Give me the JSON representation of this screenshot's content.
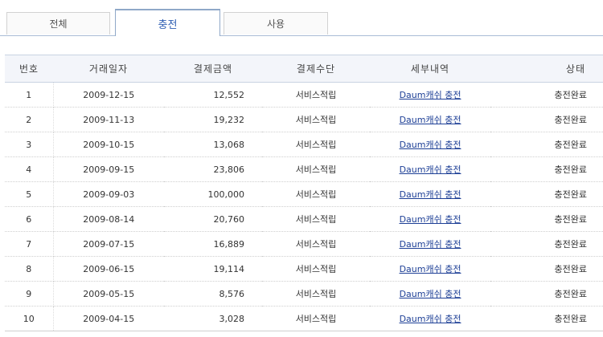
{
  "tabs": {
    "all": "전체",
    "charge": "충전",
    "use": "사용"
  },
  "columns": [
    "번호",
    "거래일자",
    "결제금액",
    "결제수단",
    "세부내역",
    "상태"
  ],
  "rows": [
    {
      "no": "1",
      "date": "2009-12-15",
      "amount": "12,552",
      "method": "서비스적립",
      "detail": "Daum캐쉬 충전",
      "status": "충전완료"
    },
    {
      "no": "2",
      "date": "2009-11-13",
      "amount": "19,232",
      "method": "서비스적립",
      "detail": "Daum캐쉬 충전",
      "status": "충전완료"
    },
    {
      "no": "3",
      "date": "2009-10-15",
      "amount": "13,068",
      "method": "서비스적립",
      "detail": "Daum캐쉬 충전",
      "status": "충전완료"
    },
    {
      "no": "4",
      "date": "2009-09-15",
      "amount": "23,806",
      "method": "서비스적립",
      "detail": "Daum캐쉬 충전",
      "status": "충전완료"
    },
    {
      "no": "5",
      "date": "2009-09-03",
      "amount": "100,000",
      "method": "서비스적립",
      "detail": "Daum캐쉬 충전",
      "status": "충전완료"
    },
    {
      "no": "6",
      "date": "2009-08-14",
      "amount": "20,760",
      "method": "서비스적립",
      "detail": "Daum캐쉬 충전",
      "status": "충전완료"
    },
    {
      "no": "7",
      "date": "2009-07-15",
      "amount": "16,889",
      "method": "서비스적립",
      "detail": "Daum캐쉬 충전",
      "status": "충전완료"
    },
    {
      "no": "8",
      "date": "2009-06-15",
      "amount": "19,114",
      "method": "서비스적립",
      "detail": "Daum캐쉬 충전",
      "status": "충전완료"
    },
    {
      "no": "9",
      "date": "2009-05-15",
      "amount": "8,576",
      "method": "서비스적립",
      "detail": "Daum캐쉬 충전",
      "status": "충전완료"
    },
    {
      "no": "10",
      "date": "2009-04-15",
      "amount": "3,028",
      "method": "서비스적립",
      "detail": "Daum캐쉬 충전",
      "status": "충전완료"
    }
  ],
  "colors": {
    "active_tab_text": "#2f5fb3",
    "link": "#1d3f96",
    "header_bg": "#f3f5fa"
  }
}
